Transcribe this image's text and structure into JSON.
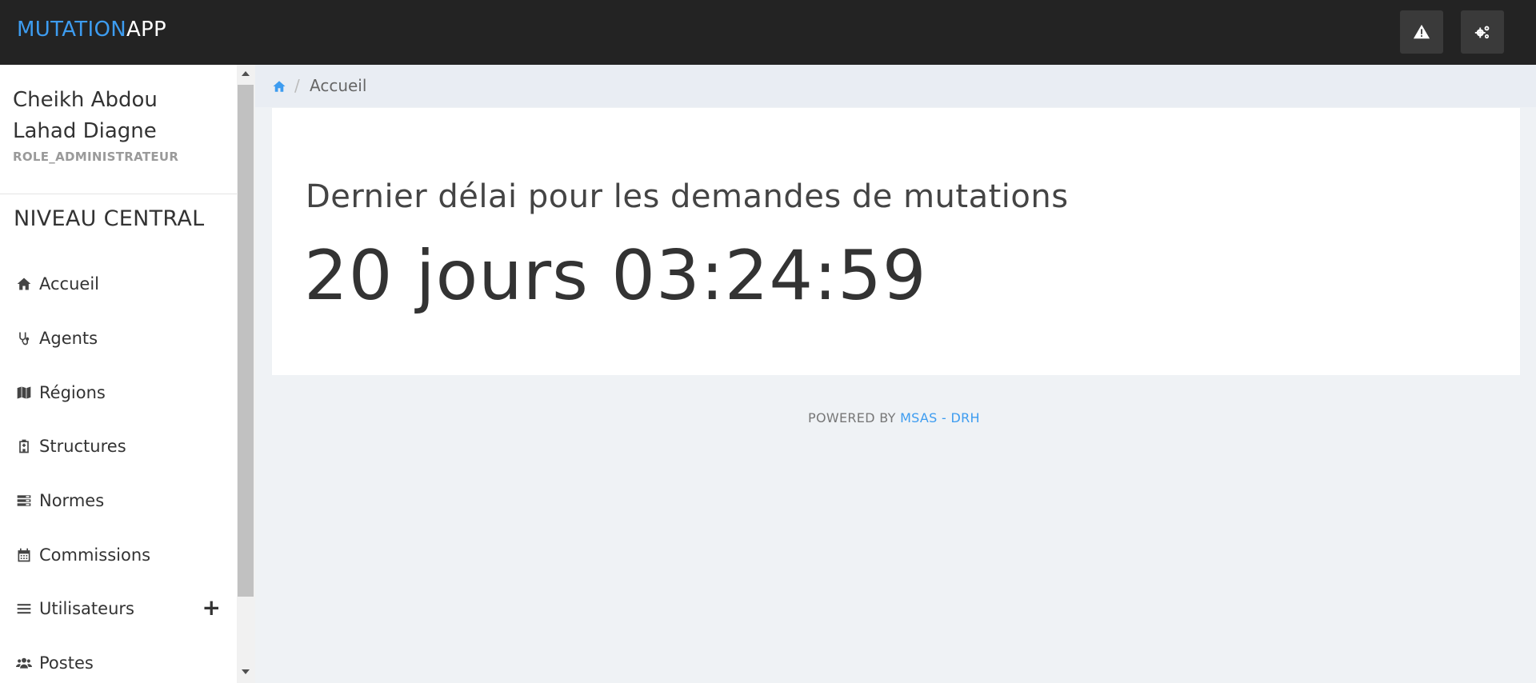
{
  "app": {
    "brand_part1": "MUTATION",
    "brand_part2": "APP"
  },
  "topbar": {
    "alert_icon": "warning-icon",
    "settings_icon": "cogs-icon"
  },
  "user": {
    "name": "Cheikh Abdou Lahad Diagne",
    "role": "ROLE_ADMINISTRATEUR"
  },
  "sidebar": {
    "section_title": "NIVEAU CENTRAL",
    "items": [
      {
        "label": "Accueil",
        "icon": "home-icon"
      },
      {
        "label": "Agents",
        "icon": "stethoscope-icon"
      },
      {
        "label": "Régions",
        "icon": "map-icon"
      },
      {
        "label": "Structures",
        "icon": "hospital-icon"
      },
      {
        "label": "Normes",
        "icon": "server-icon"
      },
      {
        "label": "Commissions",
        "icon": "calendar-icon"
      },
      {
        "label": "Utilisateurs",
        "icon": "bars-icon",
        "expand": "+"
      },
      {
        "label": "Postes",
        "icon": "users-icon"
      }
    ]
  },
  "breadcrumb": {
    "separator": "/",
    "current": "Accueil"
  },
  "main": {
    "title": "Dernier délai pour les demandes de mutations",
    "countdown": "20 jours 03:24:59"
  },
  "footer": {
    "prefix": "POWERED BY ",
    "link": "MSAS - DRH"
  },
  "colors": {
    "accent": "#3d9cf0",
    "topbar": "#232323",
    "background": "#eff2f5"
  }
}
